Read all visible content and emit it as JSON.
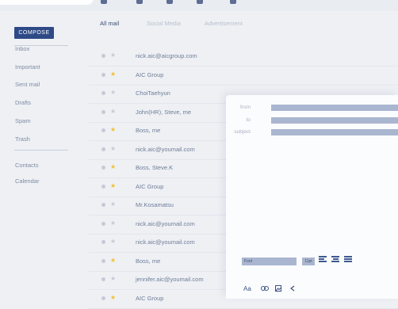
{
  "sidebar": {
    "compose_label": "COMPOSE",
    "items": [
      {
        "label": "Inbox"
      },
      {
        "label": "Important"
      },
      {
        "label": "Sent mail"
      },
      {
        "label": "Drafts"
      },
      {
        "label": "Spam"
      },
      {
        "label": "Trash"
      }
    ],
    "secondary": [
      {
        "label": "Contacts"
      },
      {
        "label": "Calendar"
      }
    ]
  },
  "tabs": [
    {
      "label": "All mail",
      "active": true
    },
    {
      "label": "Social Media",
      "active": false
    },
    {
      "label": "Advertisement",
      "active": false
    }
  ],
  "emails": [
    {
      "sender": "nick.aic@aicgroup.com",
      "starred": false
    },
    {
      "sender": "AIC Group",
      "starred": true
    },
    {
      "sender": "ChoiTaehyun",
      "starred": false
    },
    {
      "sender": "John(HR), Steve, me",
      "starred": false
    },
    {
      "sender": "Boss, me",
      "starred": true
    },
    {
      "sender": "nick.aic@youmail.com",
      "starred": false
    },
    {
      "sender": "Boss, Steve.K",
      "starred": true
    },
    {
      "sender": "AIC Group",
      "starred": true
    },
    {
      "sender": "Mr.Kosamatsu",
      "starred": false
    },
    {
      "sender": "nick.aic@youmail.com",
      "starred": false
    },
    {
      "sender": "nick.aic@youmail.com",
      "starred": false
    },
    {
      "sender": "Boss, me",
      "starred": true
    },
    {
      "sender": "jennifer.aic@youmail.com",
      "starred": false
    },
    {
      "sender": "AIC Group",
      "starred": true
    }
  ],
  "compose": {
    "from_label": "from",
    "to_label": "to",
    "subject_label": "subject",
    "font_select": "Font",
    "size_select": "11pt",
    "text_icon": "Aa",
    "toolbar_icons": [
      "link-icon",
      "image-icon",
      "share-icon"
    ]
  },
  "colors": {
    "accent": "#2e4a86",
    "star": "#f2c12e",
    "field": "#aab6d0"
  }
}
